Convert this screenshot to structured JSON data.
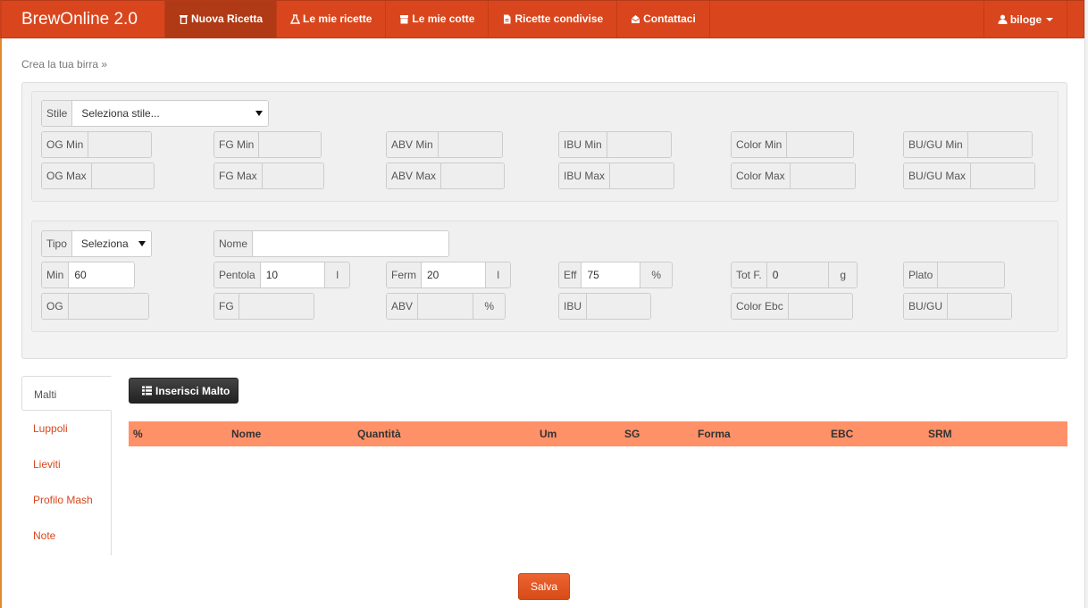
{
  "app": {
    "brand": "BrewOnline 2.0"
  },
  "nav": {
    "items": [
      {
        "label": "Nuova Ricetta",
        "icon": "trash-icon"
      },
      {
        "label": "Le mie ricette",
        "icon": "flask-icon"
      },
      {
        "label": "Le mie cotte",
        "icon": "box-icon"
      },
      {
        "label": "Ricette condivise",
        "icon": "document-icon"
      },
      {
        "label": "Contattaci",
        "icon": "envelope-icon"
      }
    ],
    "user": "biloge"
  },
  "breadcrumb": "Crea la tua birra »",
  "style_section": {
    "stile_label": "Stile",
    "stile_value": "Seleziona stile...",
    "min_fields": [
      "OG Min",
      "FG Min",
      "ABV Min",
      "IBU Min",
      "Color Min",
      "BU/GU Min"
    ],
    "max_fields": [
      "OG Max",
      "FG Max",
      "ABV Max",
      "IBU Max",
      "Color Max",
      "BU/GU Max"
    ]
  },
  "recipe_section": {
    "tipo_label": "Tipo",
    "tipo_value": "Seleziona",
    "nome_label": "Nome",
    "nome_value": "",
    "min": {
      "label": "Min",
      "value": "60"
    },
    "pentola": {
      "label": "Pentola",
      "value": "10",
      "unit": "l"
    },
    "ferm": {
      "label": "Ferm",
      "value": "20",
      "unit": "l"
    },
    "eff": {
      "label": "Eff",
      "value": "75",
      "unit": "%"
    },
    "totf": {
      "label": "Tot F.",
      "value": "0",
      "unit": "g"
    },
    "plato": {
      "label": "Plato",
      "value": ""
    },
    "og": {
      "label": "OG",
      "value": ""
    },
    "fg": {
      "label": "FG",
      "value": ""
    },
    "abv": {
      "label": "ABV",
      "value": "",
      "unit": "%"
    },
    "ibu": {
      "label": "IBU",
      "value": ""
    },
    "color_ebc": {
      "label": "Color Ebc",
      "value": ""
    },
    "bugu": {
      "label": "BU/GU",
      "value": ""
    }
  },
  "tabs": [
    "Malti",
    "Luppoli",
    "Lieviti",
    "Profilo Mash",
    "Note"
  ],
  "insert_button": "Inserisci Malto",
  "table": {
    "headers": [
      "%",
      "Nome",
      "Quantità",
      "Um",
      "SG",
      "Forma",
      "EBC",
      "SRM"
    ]
  },
  "save_button": "Salva",
  "colors": {
    "navbar": "#d9461d",
    "table_header": "#ff9168",
    "link": "#d9461d"
  }
}
